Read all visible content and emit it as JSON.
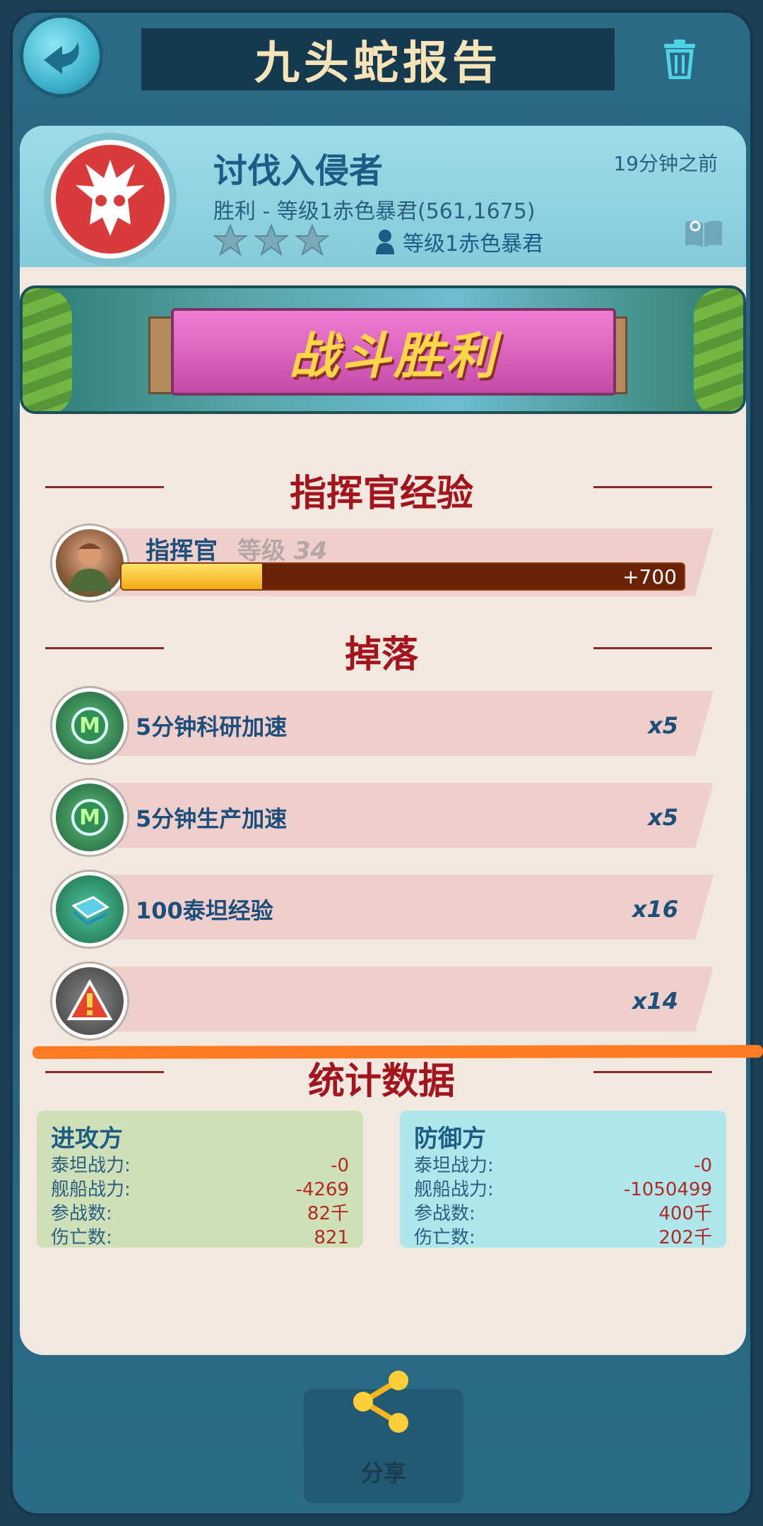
{
  "header": {
    "title": "九头蛇报告",
    "back_icon": "back-arrow-icon",
    "trash_icon": "trash-icon"
  },
  "report": {
    "title": "讨伐入侵者",
    "time_ago": "19分钟之前",
    "subtitle": "胜利 - 等级1赤色暴君(561,1675)",
    "opponent": "等级1赤色暴君",
    "stars": 3
  },
  "banner": {
    "text": "战斗胜利"
  },
  "commander": {
    "section_title": "指挥官经验",
    "name": "指挥官",
    "level_label": "等级",
    "level_value": "34",
    "xp_gain": "+700",
    "xp_progress": 0.25
  },
  "drops": {
    "section_title": "掉落",
    "items": [
      {
        "label": "5分钟科研加速",
        "qty": "x5",
        "icon": "research-speedup-icon"
      },
      {
        "label": "5分钟生产加速",
        "qty": "x5",
        "icon": "production-speedup-icon"
      },
      {
        "label": "100泰坦经验",
        "qty": "x16",
        "icon": "titan-xp-icon"
      },
      {
        "label": "",
        "qty": "x14",
        "icon": "warning-icon"
      }
    ]
  },
  "stats": {
    "section_title": "统计数据",
    "attacker": {
      "title": "进攻方",
      "rows": [
        {
          "k": "泰坦战力:",
          "v": "-0"
        },
        {
          "k": "舰船战力:",
          "v": "-4269"
        },
        {
          "k": "参战数:",
          "v": "82千"
        },
        {
          "k": "伤亡数:",
          "v": "821"
        }
      ]
    },
    "defender": {
      "title": "防御方",
      "rows": [
        {
          "k": "泰坦战力:",
          "v": "-0"
        },
        {
          "k": "舰船战力:",
          "v": "-1050499"
        },
        {
          "k": "参战数:",
          "v": "400千"
        },
        {
          "k": "伤亡数:",
          "v": "202千"
        }
      ]
    }
  },
  "share": {
    "label": "分享"
  },
  "colors": {
    "accent": "#1d5d85",
    "section_red": "#a3141d",
    "annotation_orange": "#ff7a24"
  }
}
